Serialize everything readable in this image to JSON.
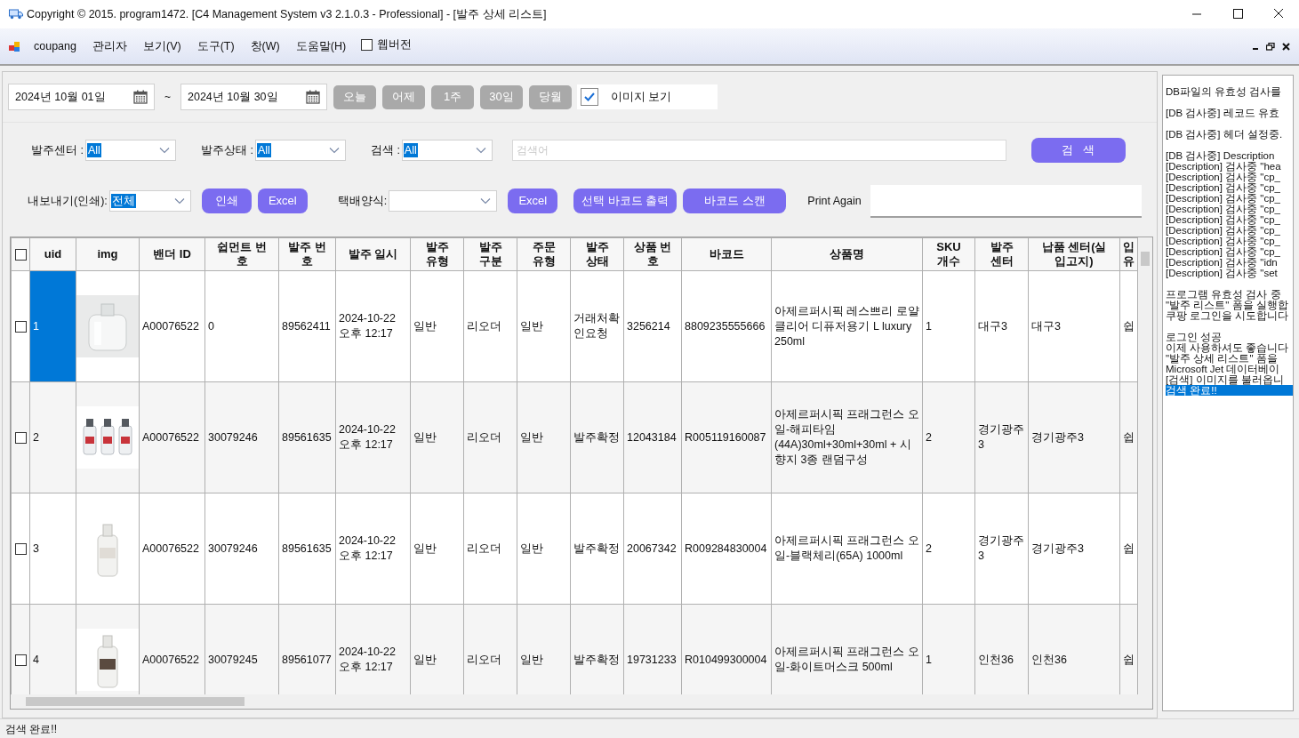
{
  "window": {
    "title": "Copyright © 2015. program1472. [C4 Management System v3 2.1.0.3 - Professional] - [발주 상세 리스트]"
  },
  "menu": {
    "items": [
      "coupang",
      "관리자",
      "보기(V)",
      "도구(T)",
      "창(W)",
      "도움말(H)"
    ],
    "web_version": {
      "label": "웹버전",
      "checked": false
    }
  },
  "toolbar": {
    "date_from": "2024년 10월 01일",
    "separator": "~",
    "date_to": "2024년 10월 30일",
    "quick_buttons": [
      "오늘",
      "어제",
      "1주",
      "30일",
      "당월"
    ],
    "show_images": {
      "label": "이미지 보기",
      "checked": true
    }
  },
  "filters": [
    {
      "label": "발주센터 :",
      "value": "All"
    },
    {
      "label": "발주상태 :",
      "value": "All"
    },
    {
      "label": "검색 :",
      "value": "All"
    }
  ],
  "search": {
    "placeholder": "검색어",
    "button": "검   색"
  },
  "export": {
    "label": "내보내기(인쇄):",
    "value": "전체",
    "buttons": [
      "인쇄",
      "Excel"
    ],
    "courier_label": "택배양식:",
    "courier_button": "Excel",
    "barcode_buttons": [
      "선택 바코드 출력",
      "바코드 스캔"
    ],
    "print_again_label": "Print Again"
  },
  "table": {
    "all_checked": false,
    "columns": [
      "uid",
      "img",
      "밴더 ID",
      "쉽먼트 번호",
      "발주 번호",
      "발주 일시",
      "발주 유형",
      "발주 구분",
      "주문 유형",
      "발주 상태",
      "상품 번호",
      "바코드",
      "상품명",
      "SKU 개수",
      "발주 센터",
      "납품 센터(실 입고지)",
      "입 유"
    ],
    "rows": [
      {
        "checked": false,
        "selected": true,
        "cells": [
          "1",
          {
            "kind": "picture"
          },
          "A00076522",
          "0",
          "89562411",
          "2024-10-22 오후 12:17",
          "일반",
          "리오더",
          "일반",
          "거래처확인요청",
          "3256214",
          "8809235555666",
          "아제르퍼시픽 레스쁘리 로얄 클리어 디퓨저용기 L luxury 250ml",
          "1",
          "대구3",
          "대구3",
          "쉽"
        ]
      },
      {
        "checked": false,
        "selected": false,
        "cells": [
          "2",
          {
            "kind": "picture"
          },
          "A00076522",
          "30079246",
          "89561635",
          "2024-10-22 오후 12:17",
          "일반",
          "리오더",
          "일반",
          "발주확정",
          "12043184",
          "R005119160087",
          "아제르퍼시픽 프래그런스 오일-해피타임 (44A)30ml+30ml+30ml + 시향지 3종 랜덤구성",
          "2",
          "경기광주3",
          "경기광주3",
          "쉽"
        ]
      },
      {
        "checked": false,
        "selected": false,
        "cells": [
          "3",
          {
            "kind": "picture"
          },
          "A00076522",
          "30079246",
          "89561635",
          "2024-10-22 오후 12:17",
          "일반",
          "리오더",
          "일반",
          "발주확정",
          "20067342",
          "R009284830004",
          "아제르퍼시픽 프래그런스 오일-블랙체리(65A) 1000ml",
          "2",
          "경기광주3",
          "경기광주3",
          "쉽"
        ]
      },
      {
        "checked": false,
        "selected": false,
        "cells": [
          "4",
          {
            "kind": "picture"
          },
          "A00076522",
          "30079245",
          "89561077",
          "2024-10-22 오후 12:17",
          "일반",
          "리오더",
          "일반",
          "발주확정",
          "19731233",
          "R010499300004",
          "아제르퍼시픽 프래그런스 오일-화이트머스크 500ml",
          "1",
          "인천36",
          "인천36",
          "쉽"
        ]
      }
    ]
  },
  "log": [
    [
      {
        "text": "DB파일의 유효성 검사를",
        "selected": false
      }
    ],
    [
      {
        "text": "[DB 검사중] 레코드 유효",
        "selected": false
      }
    ],
    [
      {
        "text": "[DB 검사중] 헤더 설정중.",
        "selected": false
      }
    ],
    [
      {
        "text": "[DB 검사중] Description",
        "selected": false
      },
      {
        "text": "[Description] 검사중 \"hea",
        "selected": false
      },
      {
        "text": "[Description] 검사중 \"cp_",
        "selected": false
      },
      {
        "text": "[Description] 검사중 \"cp_",
        "selected": false
      },
      {
        "text": "[Description] 검사중 \"cp_",
        "selected": false
      },
      {
        "text": "[Description] 검사중 \"cp_",
        "selected": false
      },
      {
        "text": "[Description] 검사중 \"cp_",
        "selected": false
      },
      {
        "text": "[Description] 검사중 \"cp_",
        "selected": false
      },
      {
        "text": "[Description] 검사중 \"cp_",
        "selected": false
      },
      {
        "text": "[Description] 검사중 \"cp_",
        "selected": false
      },
      {
        "text": "[Description] 검사중 \"idn",
        "selected": false
      },
      {
        "text": "[Description] 검사중 \"set",
        "selected": false
      }
    ],
    [
      {
        "text": "프로그램 유효성 검사 중",
        "selected": false
      },
      {
        "text": "\"발주 리스트\" 폼을 실행합",
        "selected": false
      },
      {
        "text": "쿠팡 로그인을 시도합니다",
        "selected": false
      }
    ],
    [
      {
        "text": "로그인 성공",
        "selected": false
      },
      {
        "text": "이제 사용하셔도 좋습니다",
        "selected": false
      },
      {
        "text": "\"발주 상세 리스트\" 폼을",
        "selected": false
      },
      {
        "text": "Microsoft Jet 데이터베이",
        "selected": false
      },
      {
        "text": "[검색] 이미지를 불러옵니",
        "selected": false
      },
      {
        "text": "검색 완료!!",
        "selected": true
      }
    ]
  ],
  "status_bar": "검색 완료!!"
}
